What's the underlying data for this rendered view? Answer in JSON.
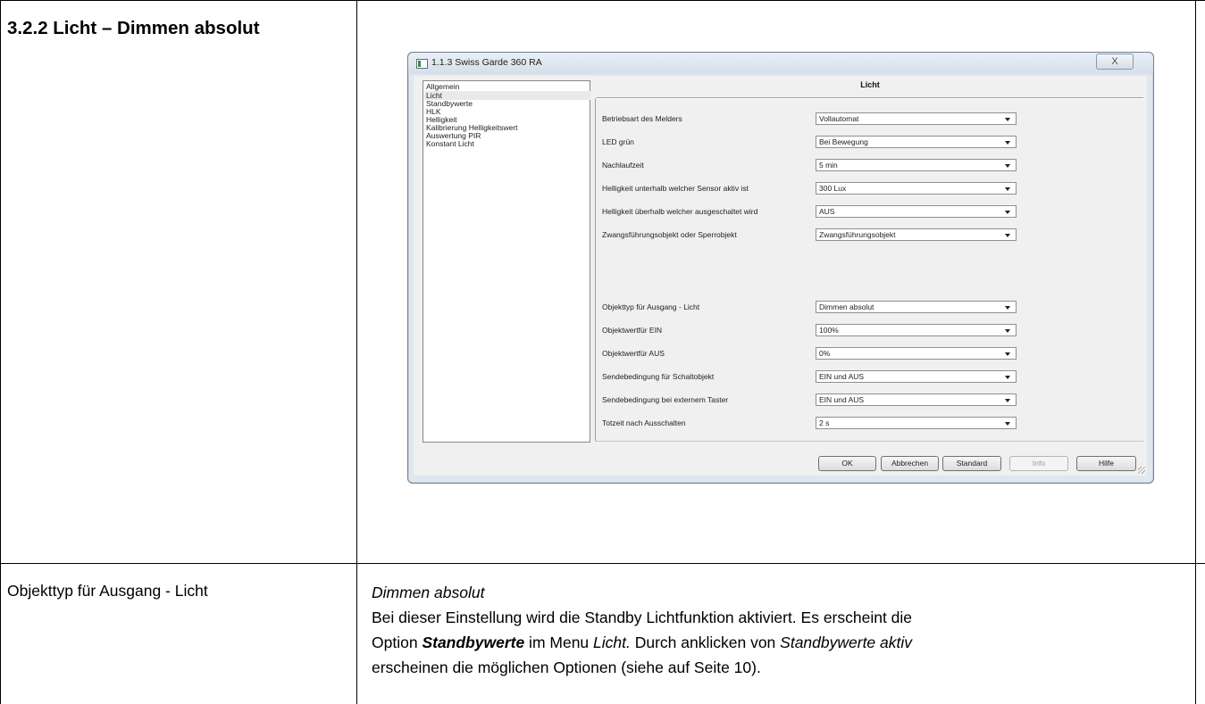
{
  "document": {
    "section_title": "3.2.2  Licht – Dimmen absolut",
    "row_label": "Objekttyp für Ausgang - Licht",
    "description": {
      "line1_italic": "Dimmen absolut",
      "line2": "Bei dieser Einstellung wird die Standby Lichtfunktion aktiviert. Es erscheint die",
      "line3_a": "Option ",
      "line3_bold": "Standbywerte",
      "line3_b": " im Menu ",
      "line3_italic": "Licht.",
      "line3_c": " Durch anklicken von ",
      "line3_italic2": "Standbywerte aktiv",
      "line4": "erscheinen die möglichen Optionen (siehe auf Seite 10)."
    }
  },
  "dialog": {
    "title": "1.1.3 Swiss Garde 360 RA",
    "close_label": "X",
    "menu_items": [
      "Allgemein",
      "Licht",
      "Standbywerte",
      "HLK",
      "Helligkeit",
      "Kalibrierung Helligkeitswert",
      "Auswertung PIR",
      "Konstant Licht"
    ],
    "selected_menu_index": 1,
    "panel_title": "Licht",
    "params": [
      {
        "label": "Betriebsart des Melders",
        "value": "Vollautomat"
      },
      {
        "label": "LED grün",
        "value": "Bei Bewegung"
      },
      {
        "label": "Nachlaufzeit",
        "value": "5 min"
      },
      {
        "label": "Helligkeit unterhalb welcher Sensor aktiv ist",
        "value": "300 Lux"
      },
      {
        "label": "Helligkeit überhalb welcher ausgeschaltet wird",
        "value": "AUS"
      },
      {
        "label": "Zwangsführungsobjekt oder Sperrobjekt",
        "value": "Zwangsführungsobjekt"
      },
      {
        "label": "Objekttyp für Ausgang - Licht",
        "value": "Dimmen absolut"
      },
      {
        "label": "Objektwertfür EIN",
        "value": "100%"
      },
      {
        "label": "Objektwertfür AUS",
        "value": "0%"
      },
      {
        "label": "Sendebedingung für Schaltobjekt",
        "value": "EIN und AUS"
      },
      {
        "label": "Sendebedingung bei externem Taster",
        "value": "EIN und AUS"
      },
      {
        "label": "Totzeit nach Ausschalten",
        "value": "2 s"
      }
    ],
    "buttons": {
      "ok": "OK",
      "cancel": "Abbrechen",
      "standard": "Standard",
      "info": "Info",
      "help": "Hilfe"
    }
  }
}
